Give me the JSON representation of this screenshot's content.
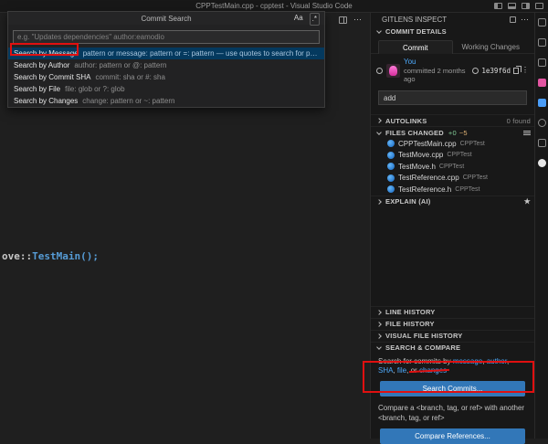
{
  "window": {
    "title": "CPPTestMain.cpp - cpptest - Visual Studio Code"
  },
  "icons": {
    "match_case": "Aa",
    "regex": ".*",
    "more_horizontal": "⋯",
    "more_vertical": "⋮",
    "sparkle": "★"
  },
  "quick_input": {
    "title": "Commit Search",
    "placeholder": "e.g. \"Updates dependencies\" author:eamodio",
    "items": [
      {
        "label": "Search by Message",
        "description": "pattern or message: pattern or =: pattern — use quotes to search for phrases"
      },
      {
        "label": "Search by Author",
        "description": "author: pattern or @: pattern"
      },
      {
        "label": "Search by Commit SHA",
        "description": "commit: sha or #: sha"
      },
      {
        "label": "Search by File",
        "description": "file: glob or ?: glob"
      },
      {
        "label": "Search by Changes",
        "description": "change: pattern or ~: pattern"
      }
    ]
  },
  "editor": {
    "code": {
      "segments": [
        {
          "t": "ove"
        },
        {
          "t": "::"
        },
        {
          "t": "TestMain"
        },
        {
          "t": "();"
        }
      ]
    }
  },
  "panel": {
    "header": {
      "title": "GITLENS INSPECT"
    },
    "commit_details": {
      "title": "COMMIT DETAILS",
      "tab_commit": "Commit",
      "tab_working": "Working Changes",
      "author": "You",
      "committed": "committed 2 months ago",
      "sha": "1e39f6d",
      "message": "add"
    },
    "autolinks": {
      "title": "AUTOLINKS",
      "count": "0 found"
    },
    "files_changed": {
      "title": "FILES CHANGED",
      "stat_added": "+0",
      "stat_modified": "~5",
      "files": [
        {
          "name": "CPPTestMain.cpp",
          "folder": "CPPTest"
        },
        {
          "name": "TestMove.cpp",
          "folder": "CPPTest"
        },
        {
          "name": "TestMove.h",
          "folder": "CPPTest"
        },
        {
          "name": "TestReference.cpp",
          "folder": "CPPTest"
        },
        {
          "name": "TestReference.h",
          "folder": "CPPTest"
        }
      ]
    },
    "explain": {
      "title": "EXPLAIN (AI)"
    },
    "line_history": {
      "title": "LINE HISTORY"
    },
    "file_history": {
      "title": "FILE HISTORY"
    },
    "visual_file_history": {
      "title": "VISUAL FILE HISTORY"
    },
    "search_compare": {
      "title": "SEARCH & COMPARE",
      "segments": [
        {
          "t": "Search for commits by "
        },
        {
          "t": "message"
        },
        {
          "t": ", "
        },
        {
          "t": "author"
        },
        {
          "t": ", "
        },
        {
          "t": "SHA"
        },
        {
          "t": ", "
        },
        {
          "t": "file"
        },
        {
          "t": ", "
        },
        {
          "t": "or "
        },
        {
          "t": "changes"
        }
      ],
      "search_button": "Search Commits...",
      "compare_text": "Compare a <branch, tag, or ref> with another <branch, tag, or ref>",
      "compare_button": "Compare References..."
    }
  },
  "colors": {
    "accent_button_blue": "#3277b8",
    "link_blue": "#4daafc",
    "list_selection_blue": "#04395e",
    "annotation_red": "#e01010",
    "added_green": "#81c995",
    "modified_yellow": "#e2b475",
    "avatar_pink": "#d62f9d",
    "file_icon_blue": "#1565c0"
  }
}
